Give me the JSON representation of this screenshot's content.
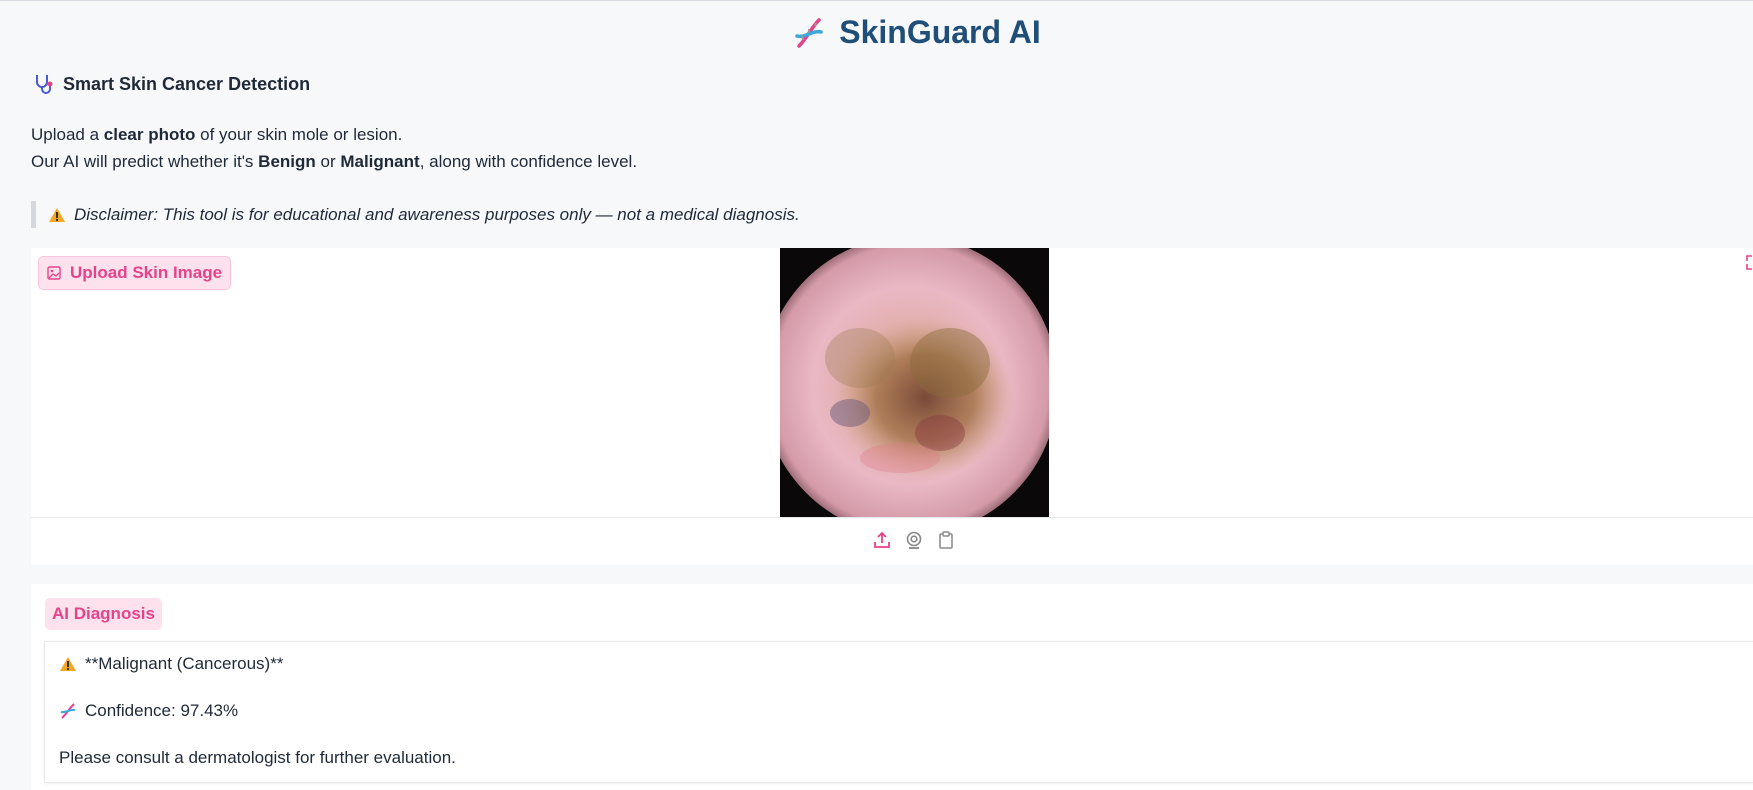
{
  "header": {
    "title": "SkinGuard AI",
    "icon": "dna-icon"
  },
  "intro": {
    "heading": "Smart Skin Cancer Detection",
    "heading_icon": "stethoscope-icon",
    "line1_prefix": "Upload a ",
    "line1_bold": "clear photo",
    "line1_suffix": " of your skin mole or lesion.",
    "line2_prefix": "Our AI will predict whether it's ",
    "line2_bold1": "Benign",
    "line2_mid": " or ",
    "line2_bold2": "Malignant",
    "line2_suffix": ", along with confidence level."
  },
  "disclaimer": {
    "text": "Disclaimer: This tool is for educational and awareness purposes only — not a medical diagnosis.",
    "icon": "warning-icon"
  },
  "upload": {
    "label": "Upload Skin Image",
    "icon": "image-icon",
    "toolbar": [
      "upload-icon",
      "webcam-icon",
      "clipboard-icon"
    ]
  },
  "diagnosis": {
    "label": "AI Diagnosis",
    "result": "**Malignant (Cancerous)**",
    "confidence": "Confidence: 97.43%",
    "advice": "Please consult a dermatologist for further evaluation."
  },
  "colors": {
    "accent": "#e6428a",
    "title": "#1f4e79",
    "background": "#f7f8fa"
  }
}
